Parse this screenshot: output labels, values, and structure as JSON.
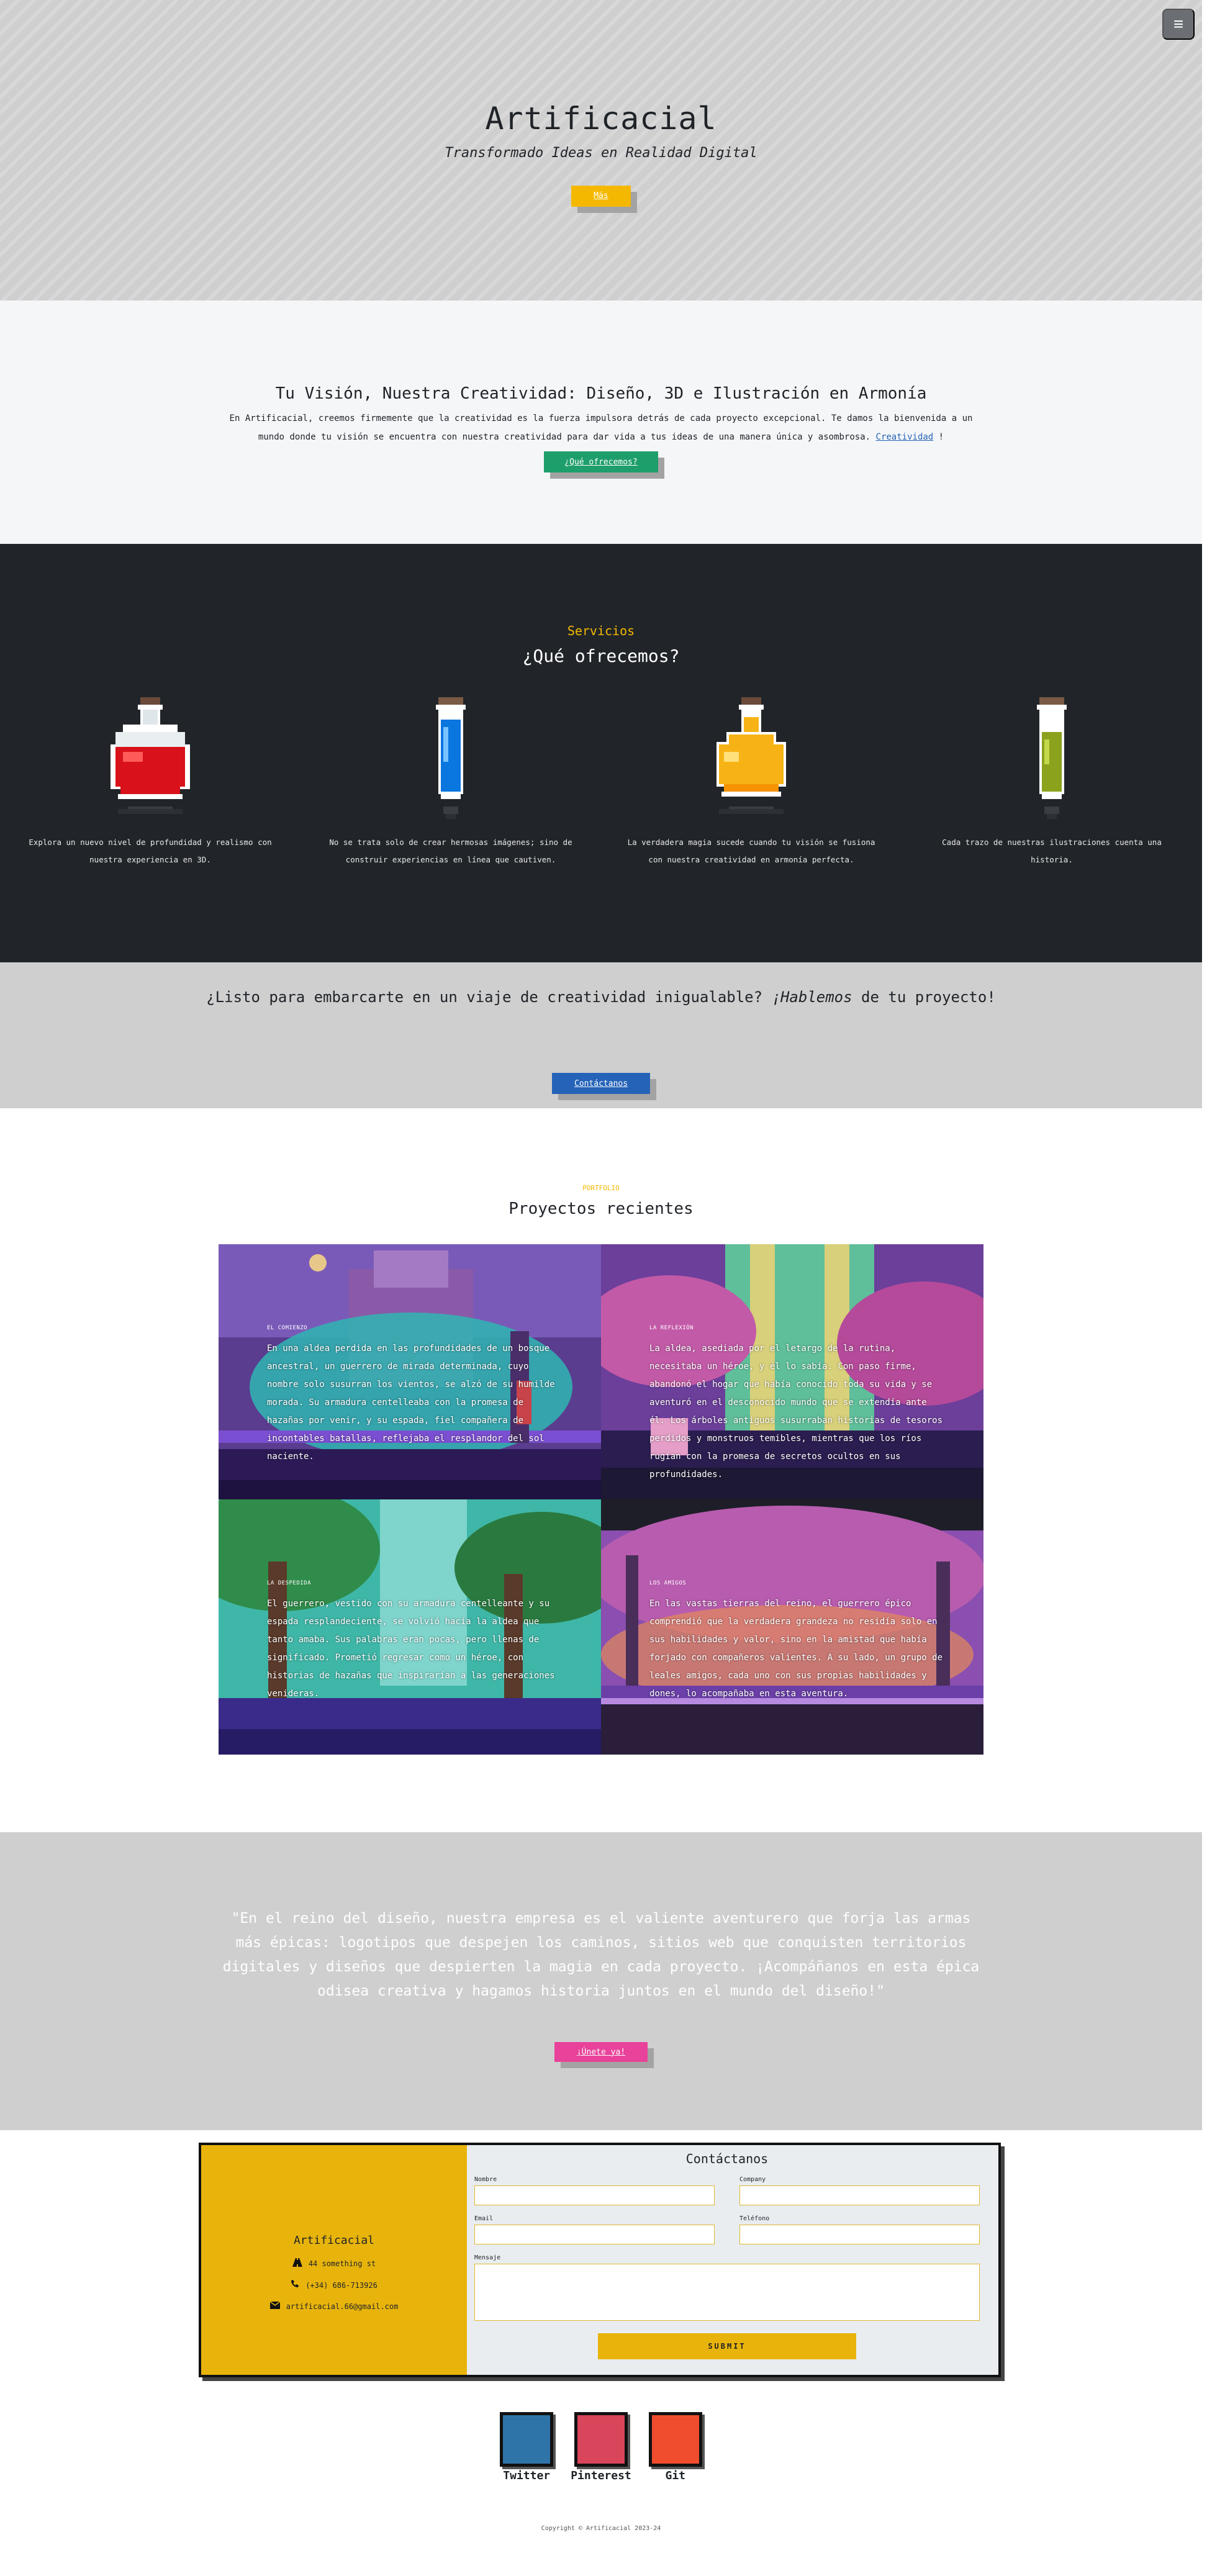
{
  "menu": {
    "icon": "hamburger-menu-icon",
    "glyph": "≡"
  },
  "hero": {
    "title": "Artificacial",
    "tagline": "Transformado Ideas en Realidad Digital",
    "button": "Más",
    "accent": "#f5b800"
  },
  "intro": {
    "heading": "Tu Visión, Nuestra Creatividad: Diseño, 3D e Ilustración en Armonía",
    "text_before_link": "En Artificacial, creemos firmemente que la creatividad es la fuerza impulsora detrás de cada proyecto excepcional. Te damos la bienvenida a un mundo donde tu visión se encuentra con nuestra creatividad para dar vida a tus ideas de una manera única y asombrosa.",
    "link": "Creatividad",
    "text_after_link": " !",
    "button": "¿Qué ofrecemos?"
  },
  "services": {
    "eyebrow": "Servicios",
    "heading": "¿Qué ofrecemos?",
    "items": [
      {
        "icon": "red-potion-flask-icon",
        "text": "Explora un nuevo nivel de profundidad y realismo con nuestra experiencia en 3D."
      },
      {
        "icon": "blue-potion-vial-icon",
        "text": "No se trata solo de crear hermosas imágenes; sino de construir experiencias en línea que cautiven."
      },
      {
        "icon": "yellow-potion-flask-icon",
        "text": "La verdadera magia sucede cuando tu visión se fusiona con nuestra creatividad en armonía perfecta."
      },
      {
        "icon": "green-potion-vial-icon",
        "text": "Cada trazo de nuestras ilustraciones cuenta una historia."
      }
    ]
  },
  "cta": {
    "text_before": "¿Listo para embarcarte en un viaje de creatividad inigualable? ",
    "text_emph": "¡Hablemos",
    "text_after": " de tu proyecto!",
    "button": "Contáctanos"
  },
  "portfolio": {
    "eyebrow": "PORTFOLIO",
    "heading": "Proyectos recientes",
    "items": [
      {
        "tag": "EL COMIENZO",
        "text": "En una aldea perdida en las profundidades de un bosque ancestral, un guerrero de mirada determinada, cuyo nombre solo susurran los vientos, se alzó de su humilde morada. Su armadura centelleaba con la promesa de hazañas por venir, y su espada, fiel compañera de incontables batallas, reflejaba el resplandor del sol naciente."
      },
      {
        "tag": "LA REFLEXIÓN",
        "text": "La aldea, asediada por el letargo de la rutina, necesitaba un héroe, y él lo sabía. Con paso firme, abandonó el hogar que había conocido toda su vida y se aventuró en el desconocido mundo que se extendía ante él. Los árboles antiguos susurraban historias de tesoros perdidos y monstruos temibles, mientras que los ríos rugían con la promesa de secretos ocultos en sus profundidades."
      },
      {
        "tag": "LA DESPEDIDA",
        "text": "El guerrero, vestido con su armadura centelleante y su espada resplandeciente, se volvió hacia la aldea que tanto amaba. Sus palabras eran pocas, pero llenas de significado. Prometió regresar como un héroe, con historias de hazañas que inspirarían a las generaciones venideras."
      },
      {
        "tag": "LOS AMIGOS",
        "text": "En las vastas tierras del reino, el guerrero épico comprendió que la verdadera grandeza no residía solo en sus habilidades y valor, sino en la amistad que había forjado con compañeros valientes. A su lado, un grupo de leales amigos, cada uno con sus propias habilidades y dones, lo acompañaba en esta aventura."
      }
    ]
  },
  "quote": {
    "text": "\"En el reino del diseño, nuestra empresa es el valiente aventurero que forja las armas más épicas: logotipos que despejen los caminos, sitios web que conquisten territorios digitales y diseños que despierten la magia en cada proyecto. ¡Acompáñanos en esta épica odisea creativa y hagamos historia juntos en el mundo del diseño!\"",
    "button": "¡Únete ya!"
  },
  "contact": {
    "name": "Artificacial",
    "address": "44 something st",
    "phone": "(+34) 686-713926",
    "email": "artificacial.66@gmail.com",
    "form_title": "Contáctanos",
    "labels": {
      "name": "Nombre",
      "company": "Company",
      "email": "Email",
      "phone": "Teléfono",
      "message": "Mensaje"
    },
    "submit": "SUBMIT"
  },
  "social": [
    {
      "label": "Twitter",
      "color": "#2f74a8"
    },
    {
      "label": "Pinterest",
      "color": "#d9455a"
    },
    {
      "label": "Git",
      "color": "#f04c2e"
    }
  ],
  "footer": "Copyright © Artificacial 2023-24"
}
